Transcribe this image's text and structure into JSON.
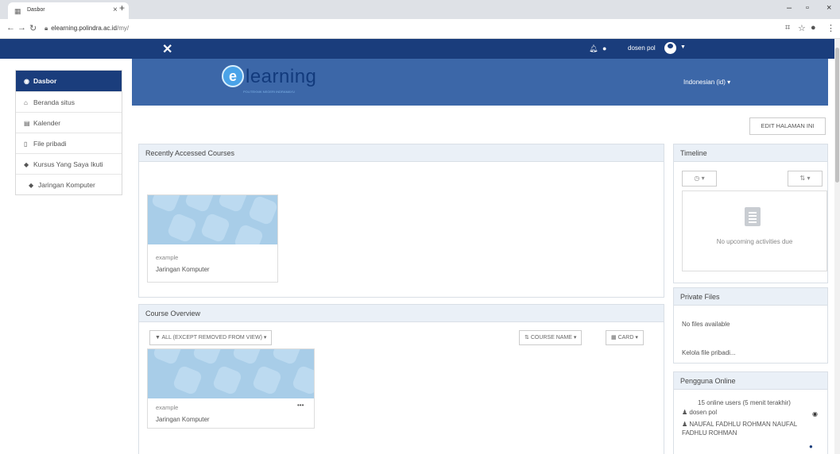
{
  "browser": {
    "tab_title": "Dasbor",
    "url_host": "elearning.polindra.ac.id",
    "url_path": "/my/"
  },
  "navbar": {
    "user_name": "dosen pol",
    "notification_icon": "bell-icon",
    "message_icon": "chat-icon"
  },
  "sidebar": {
    "items": [
      {
        "label": "Dasbor",
        "icon": "dashboard-icon",
        "active": true
      },
      {
        "label": "Beranda situs",
        "icon": "home-icon"
      },
      {
        "label": "Kalender",
        "icon": "calendar-icon"
      },
      {
        "label": "File pribadi",
        "icon": "file-icon"
      },
      {
        "label": "Kursus Yang Saya Ikuti",
        "icon": "graduation-cap-icon"
      },
      {
        "label": "Jaringan Komputer",
        "icon": "graduation-cap-icon"
      }
    ]
  },
  "header": {
    "logo_text": "learning",
    "logo_subtitle": "POLITEKNIK NEGERI INDRAMAYU",
    "language": "Indonesian (id)"
  },
  "edit_button": "EDIT HALAMAN INI",
  "recent": {
    "title": "Recently Accessed Courses",
    "course": {
      "category": "example",
      "name": "Jaringan Komputer"
    }
  },
  "overview": {
    "title": "Course Overview",
    "filter": "ALL (EXCEPT REMOVED FROM VIEW)",
    "sort": "COURSE NAME",
    "view": "CARD",
    "course": {
      "category": "example",
      "name": "Jaringan Komputer",
      "menu": "•••"
    }
  },
  "timeline": {
    "title": "Timeline",
    "empty_text": "No upcoming activities due"
  },
  "private_files": {
    "title": "Private Files",
    "empty_text": "No files available",
    "manage_link": "Kelola file pribadi..."
  },
  "online_users": {
    "title": "Pengguna Online",
    "summary": "15 online users (5 menit terakhir)",
    "users": [
      "dosen pol",
      "NAUFAL FADHLU ROHMAN NAUFAL FADHLU ROHMAN"
    ]
  },
  "colors": {
    "navbar": "#1a3d7c",
    "banner": "#3c67a8",
    "block_header": "#eaf0f7"
  }
}
